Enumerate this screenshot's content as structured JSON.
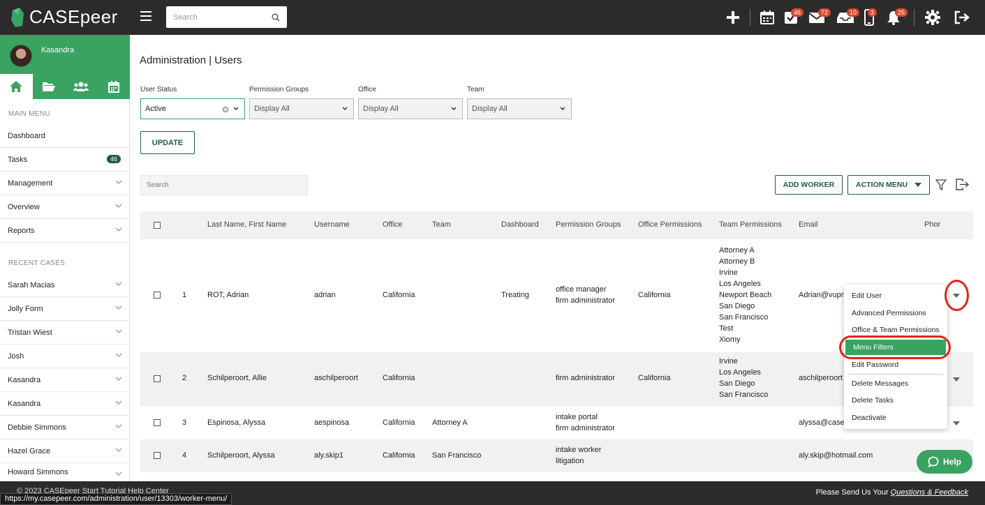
{
  "app": {
    "name": "CASEpeer",
    "brand_green": "#3aa362",
    "dark_bar": "#2b2b2b",
    "badge_red": "#d9472b"
  },
  "topbar": {
    "search_placeholder": "Search",
    "icons": [
      {
        "name": "plus-icon",
        "badge": ""
      },
      {
        "name": "calendar-icon",
        "badge": ""
      },
      {
        "name": "tasks-check-icon",
        "badge": "46"
      },
      {
        "name": "mail-icon",
        "badge": "72"
      },
      {
        "name": "inbox-icon",
        "badge": "10"
      },
      {
        "name": "phone-icon",
        "badge": "3"
      },
      {
        "name": "bell-icon",
        "badge": "25"
      },
      {
        "name": "gear-icon",
        "badge": ""
      },
      {
        "name": "logout-icon",
        "badge": ""
      }
    ]
  },
  "sidebar": {
    "user_name": "Kasandra",
    "main_menu_label": "MAIN MENU",
    "main_items": [
      {
        "label": "Dashboard",
        "badge": "",
        "chevron": false
      },
      {
        "label": "Tasks",
        "badge": "46",
        "chevron": false
      },
      {
        "label": "Management",
        "badge": "",
        "chevron": true
      },
      {
        "label": "Overview",
        "badge": "",
        "chevron": true
      },
      {
        "label": "Reports",
        "badge": "",
        "chevron": true
      }
    ],
    "recent_label": "RECENT CASES",
    "recent_items": [
      "Sarah Macias",
      "Jolly Form",
      "Tristan Wiest",
      "Josh",
      "Kasandra",
      "Kasandra",
      "Debbie Simmons",
      "Hazel Grace",
      "Howard Simmons"
    ]
  },
  "page": {
    "title": "Administration | Users",
    "filters": [
      {
        "label": "User Status",
        "value": "Active"
      },
      {
        "label": "Permission Groups",
        "value": "Display All"
      },
      {
        "label": "Office",
        "value": "Display All"
      },
      {
        "label": "Team",
        "value": "Display All"
      }
    ],
    "update_label": "UPDATE",
    "table_search_placeholder": "Search",
    "add_worker_label": "ADD WORKER",
    "action_menu_label": "ACTION MENU"
  },
  "table": {
    "headers": [
      "Last Name, First Name",
      "Username",
      "Office",
      "Team",
      "Dashboard",
      "Permission Groups",
      "Office Permissions",
      "Team Permissions",
      "Email",
      "Phor"
    ],
    "rows": [
      {
        "num": "1",
        "name": "ROT, Adrian",
        "username": "adrian",
        "office": "California",
        "team": "",
        "dashboard": "Treating",
        "permission_groups": [
          "office manager",
          "firm administrator"
        ],
        "office_permissions": "California",
        "team_permissions": [
          "Attorney A",
          "Attorney B",
          "Irvine",
          "Los Angeles",
          "Newport Beach",
          "San Diego",
          "San Francisco",
          "Test",
          "Xiomy"
        ],
        "email": "Adrian@vupm"
      },
      {
        "num": "2",
        "name": "Schilperoort, Allie",
        "username": "aschilperoort",
        "office": "California",
        "team": "",
        "dashboard": "",
        "permission_groups": [
          "firm administrator"
        ],
        "office_permissions": "California",
        "team_permissions": [
          "Irvine",
          "Los Angeles",
          "San Diego",
          "San Francisco"
        ],
        "email": "aschilperoort"
      },
      {
        "num": "3",
        "name": "Espinosa, Alyssa",
        "username": "aespinosa",
        "office": "California",
        "team": "Attorney A",
        "dashboard": "",
        "permission_groups": [
          "intake portal",
          "firm administrator"
        ],
        "office_permissions": "",
        "team_permissions": [],
        "email": "alyssa@casep"
      },
      {
        "num": "4",
        "name": "Schilperoort, Alyssa",
        "username": "aly.skip1",
        "office": "California",
        "team": "San Francisco",
        "dashboard": "",
        "permission_groups": [
          "intake worker",
          "litigation"
        ],
        "office_permissions": "",
        "team_permissions": [],
        "email": "aly.skip@hotmail.com"
      }
    ]
  },
  "row_menu": {
    "items": [
      "Edit User",
      "Advanced Permissions",
      "Office & Team Permissions",
      "Menu Filters",
      "Edit Password",
      "Delete Messages",
      "Delete Tasks",
      "Deactivate"
    ],
    "active": "Menu Filters"
  },
  "help_label": "Help",
  "footer": {
    "copyright": "© 2023 CASEpeer     Start Tutorial     Help Center",
    "feedback_prefix": "Please Send Us Your ",
    "feedback_link": "Questions & Feedback"
  },
  "status_url": "https://my.casepeer.com/administration/user/13303/worker-menu/"
}
